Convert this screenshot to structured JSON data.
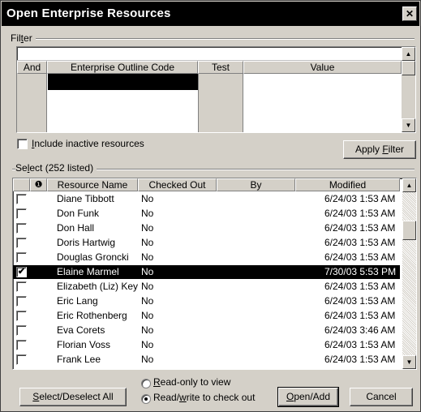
{
  "dialog": {
    "title": "Open Enterprise Resources",
    "close_glyph": "✕"
  },
  "filter": {
    "label_pre": "Fil",
    "label_key": "t",
    "label_post": "er",
    "columns": [
      "And",
      "Enterprise Outline Code",
      "Test",
      "Value"
    ]
  },
  "include_inactive": {
    "key": "I",
    "label": "nclude inactive resources",
    "checked": false
  },
  "apply_filter": {
    "pre": "Apply ",
    "key": "F",
    "post": "ilter"
  },
  "select": {
    "pre": "Se",
    "key": "l",
    "post": "ect (252 listed)"
  },
  "grid": {
    "info_glyph": "❶",
    "columns": [
      "Resource Name",
      "Checked Out",
      "By",
      "Modified"
    ],
    "rows": [
      {
        "name": "Diane Tibbott",
        "checked_out": "No",
        "by": "",
        "modified": "6/24/03 1:53 AM",
        "selected": false
      },
      {
        "name": "Don Funk",
        "checked_out": "No",
        "by": "",
        "modified": "6/24/03 1:53 AM",
        "selected": false
      },
      {
        "name": "Don Hall",
        "checked_out": "No",
        "by": "",
        "modified": "6/24/03 1:53 AM",
        "selected": false
      },
      {
        "name": "Doris Hartwig",
        "checked_out": "No",
        "by": "",
        "modified": "6/24/03 1:53 AM",
        "selected": false
      },
      {
        "name": "Douglas Groncki",
        "checked_out": "No",
        "by": "",
        "modified": "6/24/03 1:53 AM",
        "selected": false
      },
      {
        "name": "Elaine Marmel",
        "checked_out": "No",
        "by": "",
        "modified": "7/30/03 5:53 PM",
        "selected": true
      },
      {
        "name": "Elizabeth (Liz) Key",
        "checked_out": "No",
        "by": "",
        "modified": "6/24/03 1:53 AM",
        "selected": false
      },
      {
        "name": "Eric Lang",
        "checked_out": "No",
        "by": "",
        "modified": "6/24/03 1:53 AM",
        "selected": false
      },
      {
        "name": "Eric Rothenberg",
        "checked_out": "No",
        "by": "",
        "modified": "6/24/03 1:53 AM",
        "selected": false
      },
      {
        "name": "Eva Corets",
        "checked_out": "No",
        "by": "",
        "modified": "6/24/03 3:46 AM",
        "selected": false
      },
      {
        "name": "Florian Voss",
        "checked_out": "No",
        "by": "",
        "modified": "6/24/03 1:53 AM",
        "selected": false
      },
      {
        "name": "Frank Lee",
        "checked_out": "No",
        "by": "",
        "modified": "6/24/03 1:53 AM",
        "selected": false
      }
    ]
  },
  "buttons": {
    "select_all": {
      "key": "S",
      "post": "elect/Deselect All"
    },
    "open_add": {
      "key": "O",
      "post": "pen/Add"
    },
    "cancel": "Cancel"
  },
  "mode": {
    "readonly": {
      "key": "R",
      "post": "ead-only to view",
      "selected": false
    },
    "readwrite": {
      "pre": "Read/",
      "key": "w",
      "post": "rite to check out",
      "selected": true
    }
  },
  "icons": {
    "scroll_up": "▲",
    "scroll_down": "▼",
    "check": "✔"
  },
  "colors": {
    "face": "#d4d0c8",
    "selection": "#000000",
    "title_bar": "#000000"
  }
}
